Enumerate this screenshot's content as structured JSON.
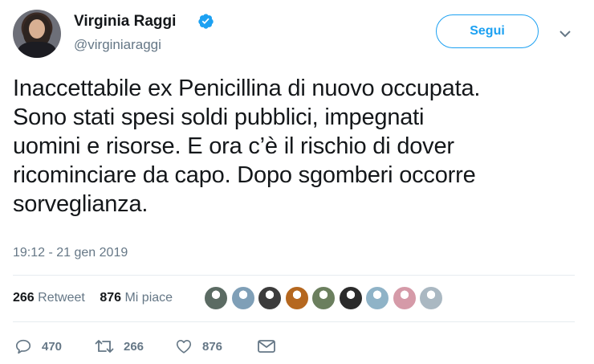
{
  "author": {
    "display_name": "Virginia Raggi",
    "handle": "@virginiaraggi",
    "verified": true
  },
  "header": {
    "follow_label": "Segui"
  },
  "tweet": {
    "text": "Inaccettabile ex Penicillina di nuovo occupata.\nSono stati spesi soldi pubblici, impegnati\nuomini e risorse. E ora c’è il rischio di dover\nricominciare da capo. Dopo sgomberi occorre\nsorveglianza.",
    "timestamp": "19:12 - 21 gen 2019"
  },
  "stats": {
    "retweets_count": "266",
    "retweets_label": "Retweet",
    "likes_count": "876",
    "likes_label": "Mi piace"
  },
  "likers": [
    {
      "color": "#5b6b63"
    },
    {
      "color": "#7f9fb7"
    },
    {
      "color": "#3c3c3c"
    },
    {
      "color": "#b5671f"
    },
    {
      "color": "#6b7f5e"
    },
    {
      "color": "#2b2b2b"
    },
    {
      "color": "#8fb3c7"
    },
    {
      "color": "#d59aa8"
    },
    {
      "color": "#aab8c2"
    }
  ],
  "actions": {
    "reply_count": "470",
    "retweet_count": "266",
    "like_count": "876"
  },
  "colors": {
    "accent": "#1da1f2",
    "secondary_text": "#657786",
    "divider": "#e6ecf0"
  }
}
